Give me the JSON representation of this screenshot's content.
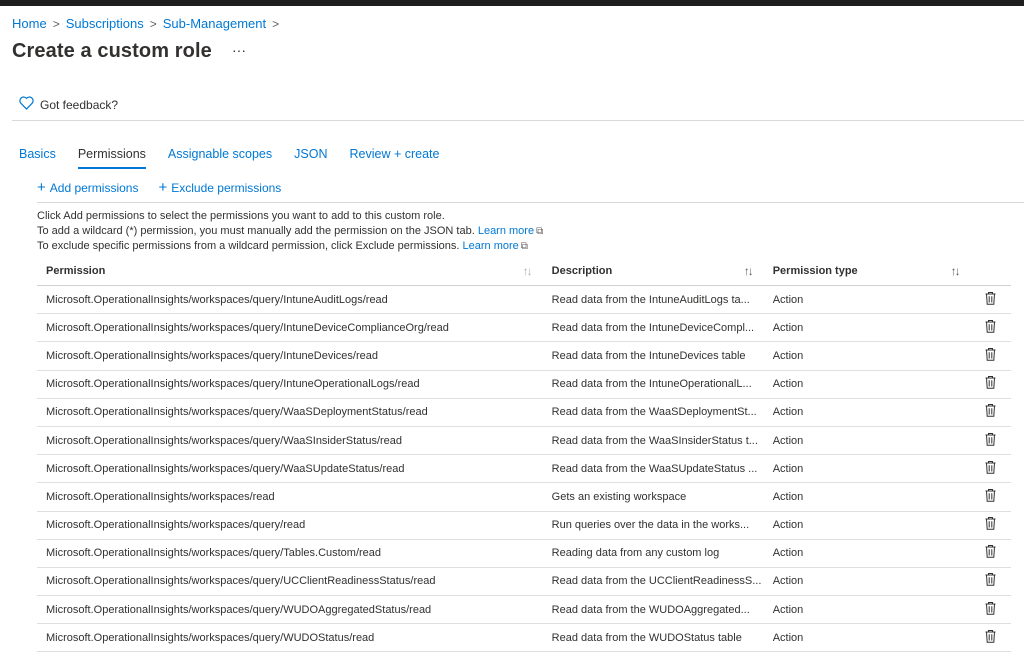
{
  "breadcrumb": {
    "items": [
      "Home",
      "Subscriptions",
      "Sub-Management"
    ],
    "separator": ">"
  },
  "page": {
    "title": "Create a custom role",
    "more_label": "···"
  },
  "feedback": {
    "label": "Got feedback?"
  },
  "tabs": [
    {
      "label": "Basics",
      "active": false
    },
    {
      "label": "Permissions",
      "active": true
    },
    {
      "label": "Assignable scopes",
      "active": false
    },
    {
      "label": "JSON",
      "active": false
    },
    {
      "label": "Review + create",
      "active": false
    }
  ],
  "actions": {
    "add_label": "Add permissions",
    "exclude_label": "Exclude permissions"
  },
  "info": {
    "line1": "Click Add permissions to select the permissions you want to add to this custom role.",
    "line2": "To add a wildcard (*) permission, you must manually add the permission on the JSON tab.",
    "line3": "To exclude specific permissions from a wildcard permission, click Exclude permissions.",
    "learn_more": "Learn more"
  },
  "table": {
    "columns": [
      "Permission",
      "Description",
      "Permission type"
    ],
    "rows": [
      {
        "permission": "Microsoft.OperationalInsights/workspaces/query/IntuneAuditLogs/read",
        "description": "Read data from the IntuneAuditLogs ta...",
        "type": "Action"
      },
      {
        "permission": "Microsoft.OperationalInsights/workspaces/query/IntuneDeviceComplianceOrg/read",
        "description": "Read data from the IntuneDeviceCompl...",
        "type": "Action"
      },
      {
        "permission": "Microsoft.OperationalInsights/workspaces/query/IntuneDevices/read",
        "description": "Read data from the IntuneDevices table",
        "type": "Action"
      },
      {
        "permission": "Microsoft.OperationalInsights/workspaces/query/IntuneOperationalLogs/read",
        "description": "Read data from the IntuneOperationalL...",
        "type": "Action"
      },
      {
        "permission": "Microsoft.OperationalInsights/workspaces/query/WaaSDeploymentStatus/read",
        "description": "Read data from the WaaSDeploymentSt...",
        "type": "Action"
      },
      {
        "permission": "Microsoft.OperationalInsights/workspaces/query/WaaSInsiderStatus/read",
        "description": "Read data from the WaaSInsiderStatus t...",
        "type": "Action"
      },
      {
        "permission": "Microsoft.OperationalInsights/workspaces/query/WaaSUpdateStatus/read",
        "description": "Read data from the WaaSUpdateStatus ...",
        "type": "Action"
      },
      {
        "permission": "Microsoft.OperationalInsights/workspaces/read",
        "description": "Gets an existing workspace",
        "type": "Action"
      },
      {
        "permission": "Microsoft.OperationalInsights/workspaces/query/read",
        "description": "Run queries over the data in the works...",
        "type": "Action"
      },
      {
        "permission": "Microsoft.OperationalInsights/workspaces/query/Tables.Custom/read",
        "description": "Reading data from any custom log",
        "type": "Action"
      },
      {
        "permission": "Microsoft.OperationalInsights/workspaces/query/UCClientReadinessStatus/read",
        "description": "Read data from the UCClientReadinessS...",
        "type": "Action"
      },
      {
        "permission": "Microsoft.OperationalInsights/workspaces/query/WUDOAggregatedStatus/read",
        "description": "Read data from the WUDOAggregated...",
        "type": "Action"
      },
      {
        "permission": "Microsoft.OperationalInsights/workspaces/query/WUDOStatus/read",
        "description": "Read data from the WUDOStatus table",
        "type": "Action"
      }
    ]
  },
  "icons": {
    "heart": "heart-icon",
    "plus": "plus-icon",
    "external_link": "external-link-icon",
    "sort": "sort-icon",
    "delete": "trash-icon"
  },
  "colors": {
    "accent": "#0078d4",
    "text": "#323130",
    "top_bar": "#1f1f1f"
  }
}
